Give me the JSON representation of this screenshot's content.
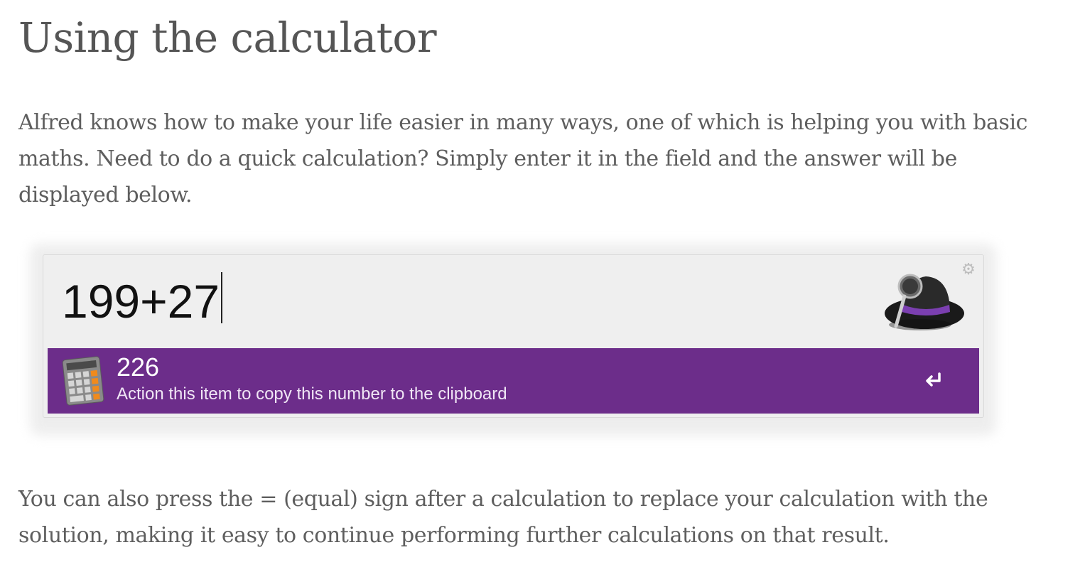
{
  "article": {
    "title": "Using the calculator",
    "intro": "Alfred knows how to make your life easier in many ways, one of which is helping you with basic maths. Need to do a quick calculation? Simply enter it in the field and the answer will be displayed below.",
    "outro": "You can also press the = (equal) sign after a calculation to replace your calculation with the solution, making it easy to continue performing further calculations on that result."
  },
  "alfred": {
    "query": "199+27",
    "result": {
      "title": "226",
      "subtitle": "Action this item to copy this number to the clipboard"
    },
    "icons": {
      "settings": "gear-icon",
      "app": "alfred-hat-icon",
      "result": "calculator-icon",
      "action": "return-key-icon"
    },
    "colors": {
      "selection": "#6c2d8a",
      "window": "#efefef"
    }
  }
}
